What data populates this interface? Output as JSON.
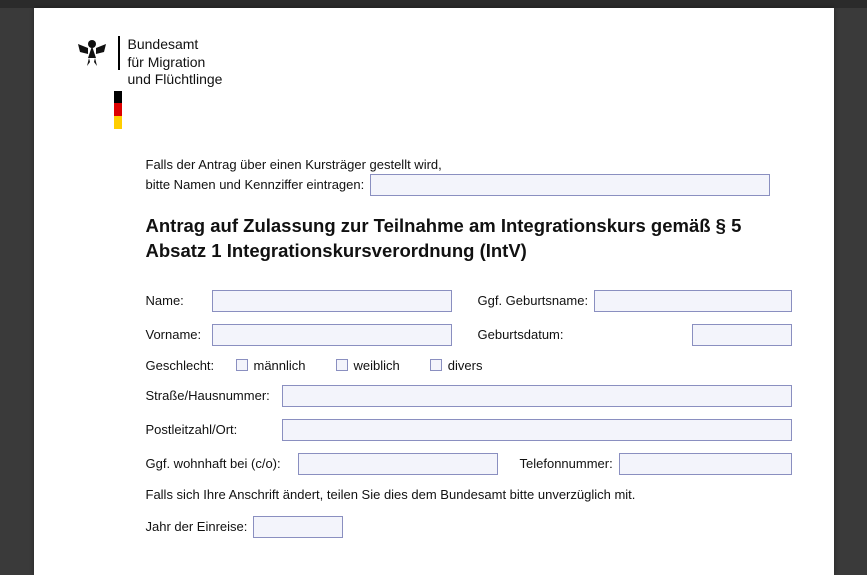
{
  "agency": {
    "line1": "Bundesamt",
    "line2": "für Migration",
    "line3": "und Flüchtlinge"
  },
  "intro": {
    "line1": "Falls der Antrag über einen Kursträger gestellt wird,",
    "line2": "bitte Namen und Kennziffer eintragen:"
  },
  "title": "Antrag auf Zulassung zur Teilnahme am Integrationskurs gemäß § 5 Absatz 1 Integrationskursverordnung (IntV)",
  "labels": {
    "name": "Name:",
    "geburtsname": "Ggf. Geburtsname:",
    "vorname": "Vorname:",
    "geburtsdatum": "Geburtsdatum:",
    "geschlecht": "Geschlecht:",
    "maennlich": "männlich",
    "weiblich": "weiblich",
    "divers": "divers",
    "strasse": "Straße/Hausnummer:",
    "plzort": "Postleitzahl/Ort:",
    "co": "Ggf. wohnhaft bei (c/o):",
    "telefon": "Telefonnummer:",
    "note": "Falls sich Ihre Anschrift ändert, teilen Sie dies dem Bundesamt bitte unverzüglich mit.",
    "jahr": "Jahr der Einreise:"
  }
}
